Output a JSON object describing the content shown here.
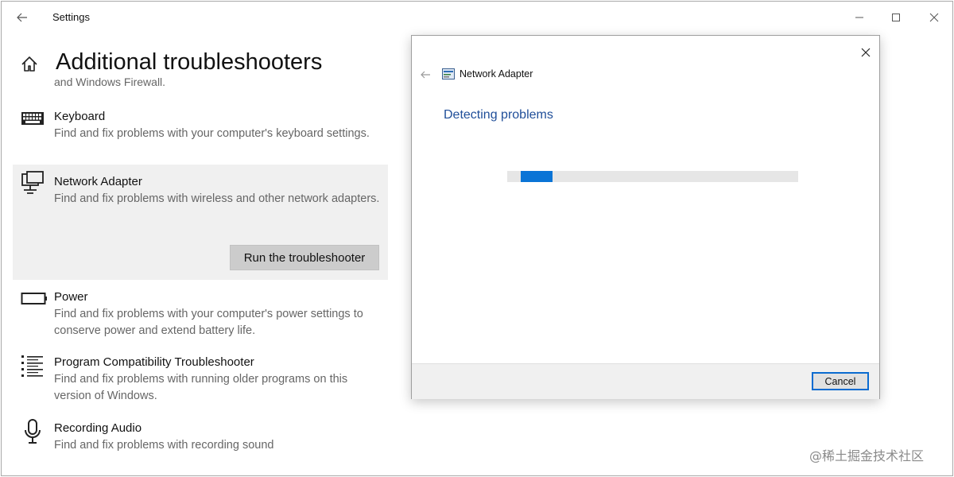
{
  "window": {
    "title": "Settings",
    "back_icon": "back-arrow-icon",
    "minimize_icon": "minimize-icon",
    "maximize_icon": "maximize-icon",
    "close_icon": "close-icon"
  },
  "page": {
    "title": "Additional troubleshooters",
    "home_icon": "home-icon",
    "clipped_text": "and Windows Firewall."
  },
  "troubleshooters": [
    {
      "name": "Keyboard",
      "description": "Find and fix problems with your computer's keyboard settings.",
      "icon": "keyboard-icon"
    },
    {
      "name": "Network Adapter",
      "description": "Find and fix problems with wireless and other network adapters.",
      "icon": "network-adapter-icon",
      "selected": true,
      "button": "Run the troubleshooter"
    },
    {
      "name": "Power",
      "description": "Find and fix problems with your computer's power settings to conserve power and extend battery life.",
      "icon": "battery-icon"
    },
    {
      "name": "Program Compatibility Troubleshooter",
      "description": "Find and fix problems with running older programs on this version of Windows.",
      "icon": "list-icon"
    },
    {
      "name": "Recording Audio",
      "description": "Find and fix problems with recording sound",
      "icon": "microphone-icon"
    }
  ],
  "dialog": {
    "title": "Network Adapter",
    "heading": "Detecting problems",
    "progress": 0.11,
    "cancel_label": "Cancel",
    "accent_color": "#0a74d6",
    "heading_color": "#1f4e99"
  },
  "watermark": "@稀土掘金技术社区"
}
